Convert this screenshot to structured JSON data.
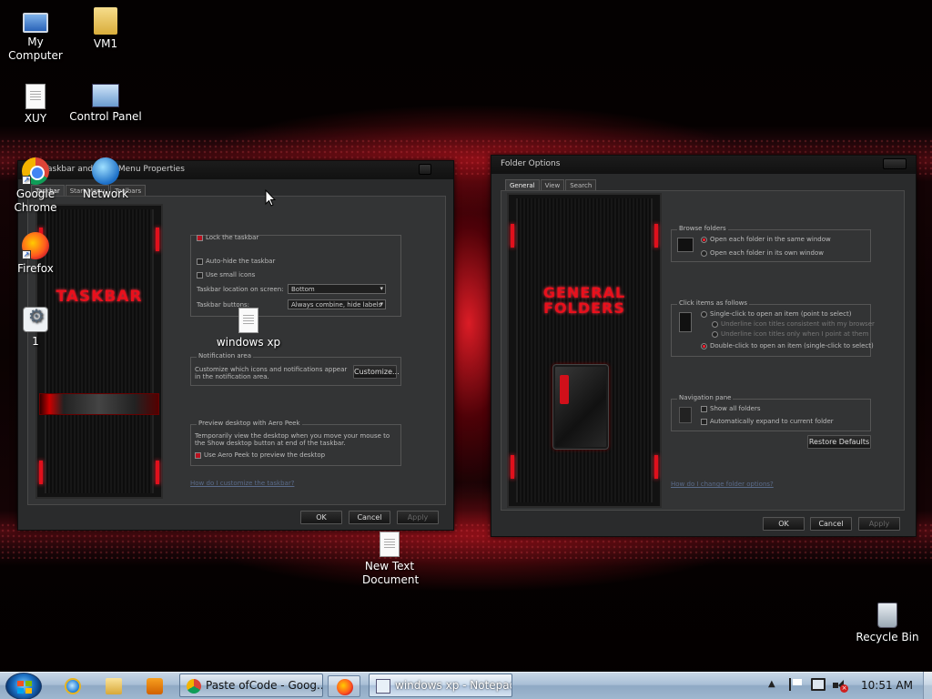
{
  "desktop": {
    "icons": [
      {
        "label": "My Computer",
        "icon": "computer-icon"
      },
      {
        "label": "VM1",
        "icon": "user-folder-icon"
      },
      {
        "label": "XUY",
        "icon": "text-document-icon"
      },
      {
        "label": "Control Panel",
        "icon": "control-panel-icon"
      },
      {
        "label": "Google Chrome",
        "icon": "chrome-icon"
      },
      {
        "label": "Network",
        "icon": "network-icon"
      },
      {
        "label": "Firefox",
        "icon": "firefox-icon"
      },
      {
        "label": "1",
        "icon": "settings-file-icon"
      },
      {
        "label": "windows xp",
        "icon": "text-document-icon"
      },
      {
        "label": "New Text Document",
        "icon": "text-document-icon"
      },
      {
        "label": "Recycle Bin",
        "icon": "recycle-bin-icon"
      }
    ]
  },
  "taskbar_props": {
    "title": "Taskbar and Start Menu Properties",
    "tabs": [
      "Taskbar",
      "Start Menu",
      "Toolbars"
    ],
    "preview_text": "TASKBAR",
    "appearance": {
      "lock": "Lock the taskbar",
      "autohide": "Auto-hide the taskbar",
      "small_icons": "Use small icons",
      "location_label": "Taskbar location on screen:",
      "location_value": "Bottom",
      "buttons_label": "Taskbar buttons:",
      "buttons_value": "Always combine, hide labels"
    },
    "notification": {
      "title": "Notification area",
      "text": "Customize which icons and notifications appear in the notification area.",
      "button": "Customize..."
    },
    "aero": {
      "title": "Preview desktop with Aero Peek",
      "text": "Temporarily view the desktop when you move your mouse to the Show desktop button at end of the taskbar.",
      "option": "Use Aero Peek to preview the desktop"
    },
    "help_link": "How do I customize the taskbar?",
    "ok": "OK",
    "cancel": "Cancel",
    "apply": "Apply"
  },
  "folder_options": {
    "title": "Folder Options",
    "tabs": [
      "General",
      "View",
      "Search"
    ],
    "preview_line1": "GENERAL",
    "preview_line2": "FOLDERS",
    "browse": {
      "title": "Browse folders",
      "same_window": "Open each folder in the same window",
      "own_window": "Open each folder in its own window"
    },
    "click": {
      "title": "Click items as follows",
      "single": "Single-click to open an item (point to select)",
      "underline_browser": "Underline icon titles consistent with my browser",
      "underline_point": "Underline icon titles only when I point at them",
      "double": "Double-click to open an item (single-click to select)"
    },
    "nav": {
      "title": "Navigation pane",
      "show_all": "Show all folders",
      "expand": "Automatically expand to current folder"
    },
    "restore": "Restore Defaults",
    "help_link": "How do I change folder options?",
    "ok": "OK",
    "cancel": "Cancel",
    "apply": "Apply"
  },
  "taskbar": {
    "items": [
      {
        "label": "Paste ofCode - Goog...",
        "icon": "chrome-icon"
      },
      {
        "label": "windows xp - Notepad",
        "icon": "notepad-icon"
      }
    ],
    "clock": "10:51 AM"
  }
}
